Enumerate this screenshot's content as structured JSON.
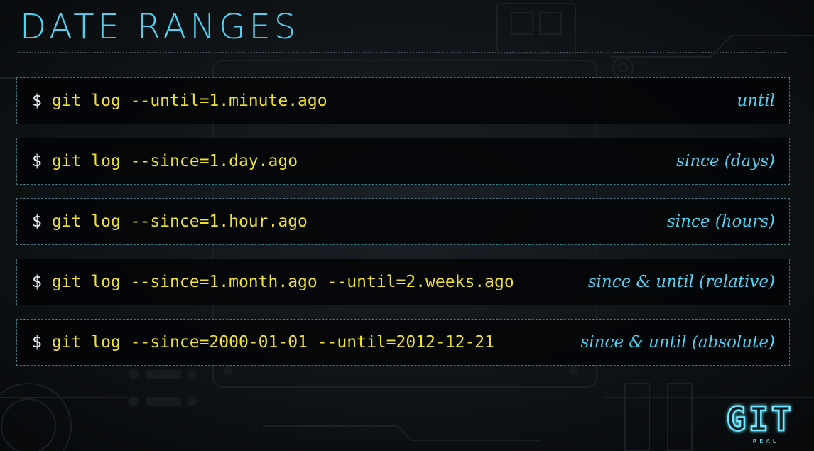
{
  "slide": {
    "title": "DATE RANGES"
  },
  "prompt_symbol": "$",
  "rows": [
    {
      "command": "git log --until=1.minute.ago",
      "label": "until"
    },
    {
      "command": "git log --since=1.day.ago",
      "label": "since (days)"
    },
    {
      "command": "git log --since=1.hour.ago",
      "label": "since (hours)"
    },
    {
      "command": "git log --since=1.month.ago --until=2.weeks.ago",
      "label": "since & until (relative)"
    },
    {
      "command": "git log --since=2000-01-01 --until=2012-12-21",
      "label": "since & until (absolute)"
    }
  ],
  "logo": {
    "main": "GIT",
    "sub": "REAL"
  },
  "colors": {
    "title": "#4fd3f2",
    "code": "#f0e130",
    "prompt": "#e9eef0",
    "label": "#4fd3f2",
    "border": "#3f7a85",
    "background": "#0d1013"
  }
}
